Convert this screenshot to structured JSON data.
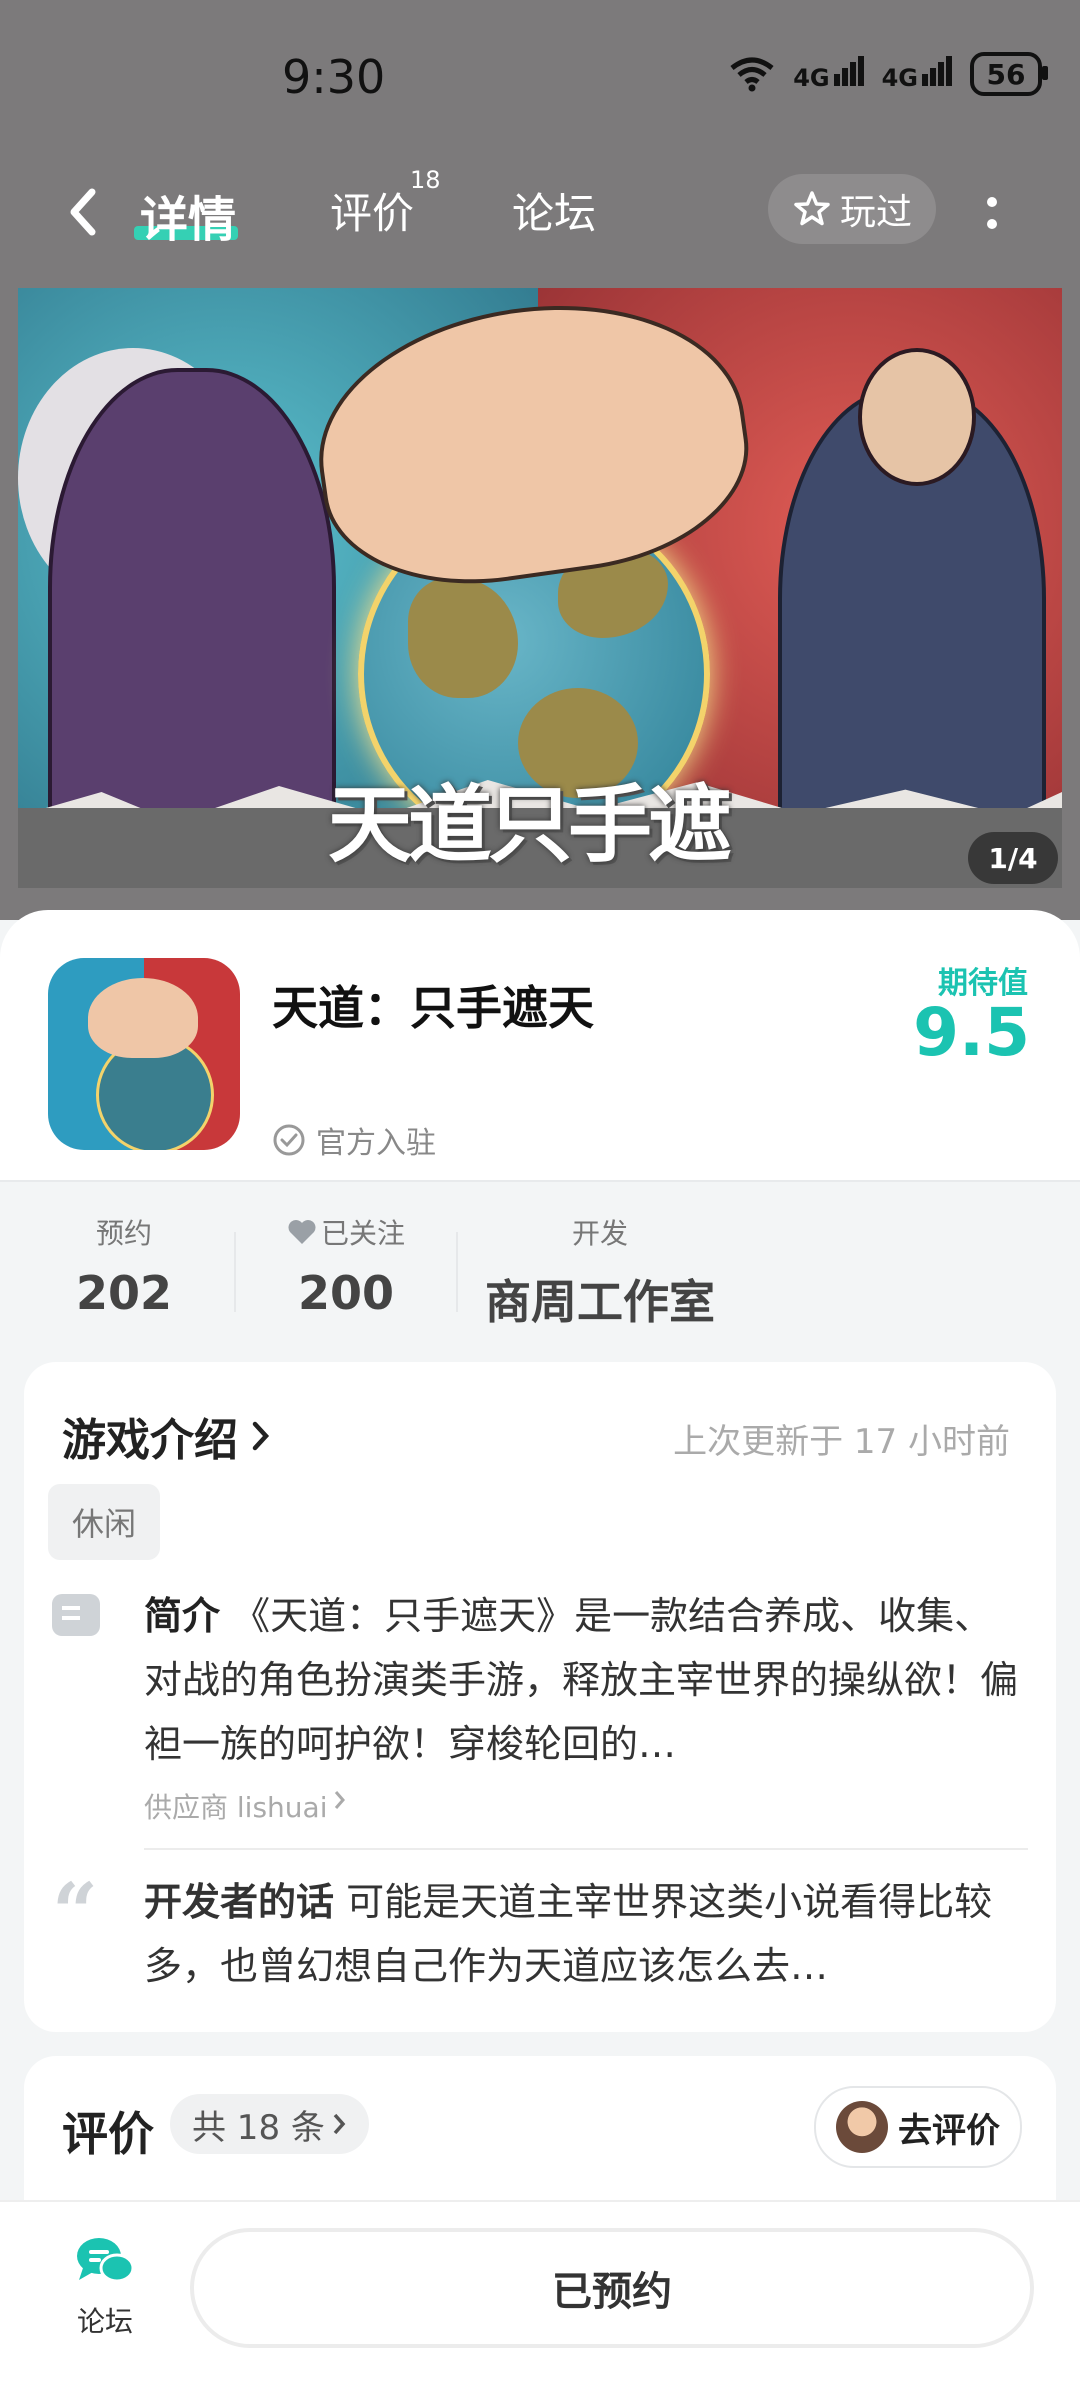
{
  "status_bar": {
    "time": "9:30",
    "signal1": "4G",
    "signal2": "4G",
    "battery": "56"
  },
  "nav": {
    "tab_detail": "详情",
    "tab_review": "评价",
    "tab_review_count": "18",
    "tab_forum": "论坛",
    "played_label": "玩过"
  },
  "banner": {
    "logo_text": "天道只手遮天",
    "pager": "1/4"
  },
  "game": {
    "title": "天道：只手遮天",
    "official": "官方入驻",
    "expect_label": "期待值",
    "expect_value": "9.5"
  },
  "stats": {
    "reserve_label": "预约",
    "reserve_value": "202",
    "follow_label": "已关注",
    "follow_value": "200",
    "dev_label": "开发",
    "dev_value": "商周工作室"
  },
  "intro": {
    "title": "游戏介绍",
    "updated": "上次更新于 17 小时前",
    "tag": "休闲",
    "desc_label": "简介",
    "desc_text": "《天道：只手遮天》是一款结合养成、收集、对战的角色扮演类手游，释放主宰世界的操纵欲！偏袒一族的呵护欲！穿梭轮回的…",
    "supplier": "供应商 lishuai",
    "dev_label": "开发者的话",
    "dev_text": "可能是天道主宰世界这类小说看得比较多，也曾幻想自己作为天道应该怎么去…"
  },
  "reviews": {
    "title": "评价",
    "count": "共 18 条",
    "go_review": "去评价"
  },
  "bottom": {
    "forum_label": "论坛",
    "reserved_label": "已预约"
  },
  "colors": {
    "accent": "#1bc3b1",
    "underline": "#35d0b4",
    "header_bg": "#7c7a7b"
  }
}
